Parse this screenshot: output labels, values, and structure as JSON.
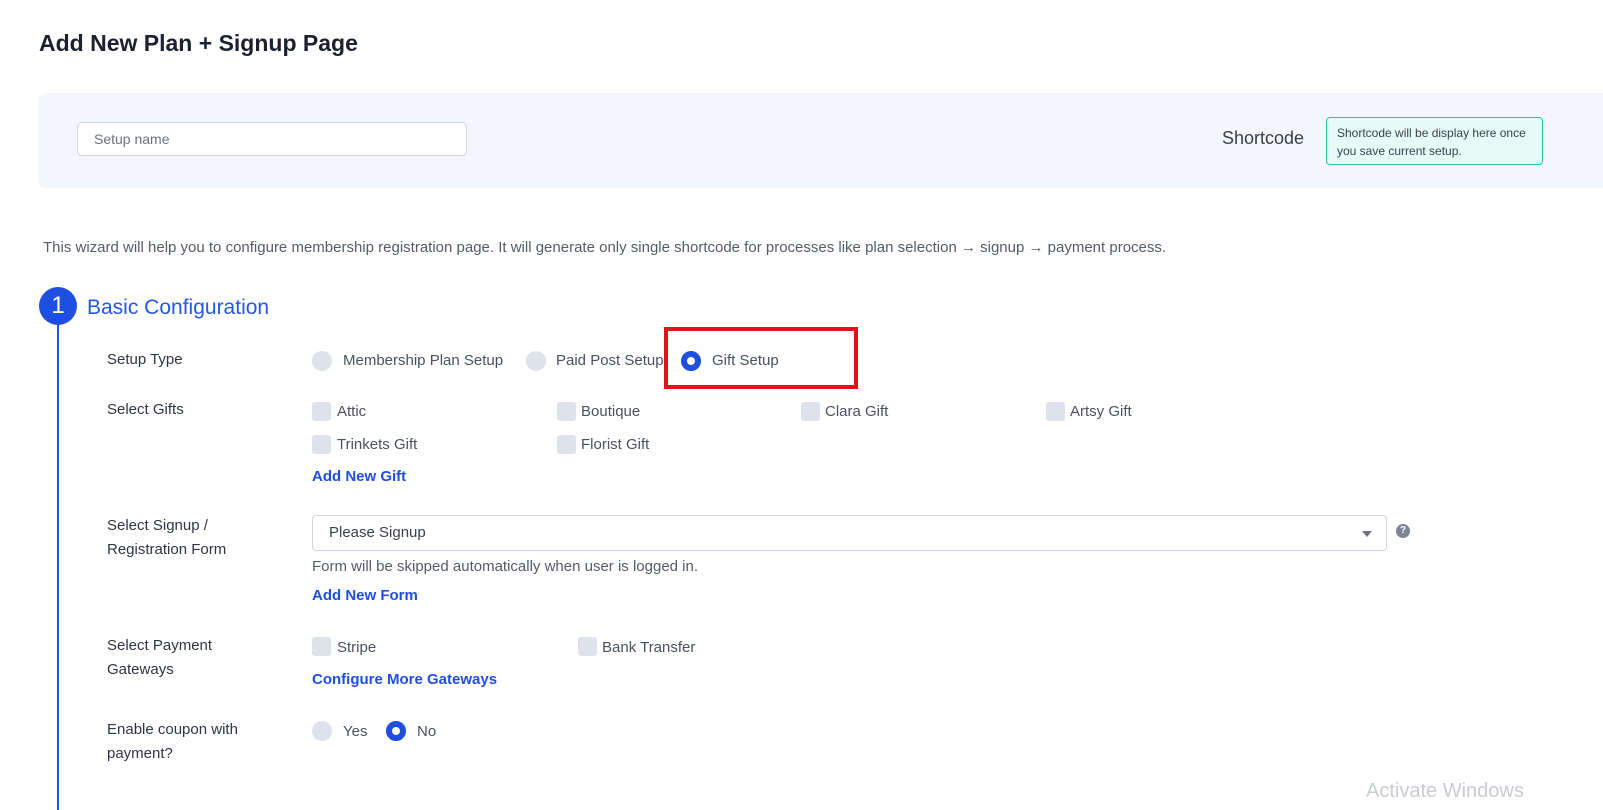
{
  "page": {
    "title": "Add New Plan + Signup Page"
  },
  "setup": {
    "name_placeholder": "Setup name",
    "shortcode_label": "Shortcode",
    "shortcode_box_text": "Shortcode will be display here once you save current setup."
  },
  "intro": "This wizard will help you to configure membership registration page. It will generate only single shortcode for processes like plan selection → signup → payment process.",
  "step": {
    "number": "1",
    "title": "Basic Configuration"
  },
  "setup_type": {
    "label": "Setup Type",
    "options": [
      {
        "label": "Membership Plan Setup",
        "checked": false
      },
      {
        "label": "Paid Post Setup",
        "checked": false
      },
      {
        "label": "Gift Setup",
        "checked": true
      }
    ]
  },
  "gifts": {
    "label": "Select Gifts",
    "options": [
      "Attic",
      "Boutique",
      "Clara Gift",
      "Artsy Gift",
      "Trinkets Gift",
      "Florist Gift"
    ],
    "add_link": "Add New Gift"
  },
  "signup_form": {
    "label": "Select Signup / Registration Form",
    "selected": "Please Signup",
    "help": "?",
    "hint": "Form will be skipped automatically when user is logged in.",
    "add_link": "Add New Form"
  },
  "gateways": {
    "label": "Select Payment Gateways",
    "options": [
      "Stripe",
      "Bank Transfer"
    ],
    "configure_link": "Configure More Gateways"
  },
  "coupon": {
    "label": "Enable coupon with payment?",
    "options": [
      {
        "label": "Yes",
        "checked": false
      },
      {
        "label": "No",
        "checked": true
      }
    ]
  },
  "watermark": "Activate Windows",
  "colors": {
    "accent": "#1f4fe0",
    "highlight": "#e0121b",
    "shortcode_border": "#2dc0a8"
  }
}
